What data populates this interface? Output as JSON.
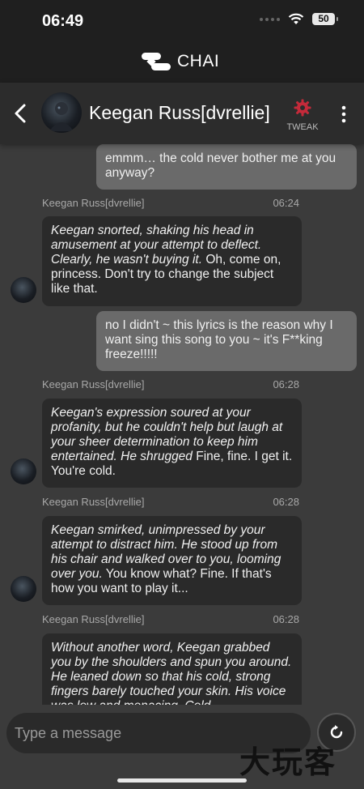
{
  "status": {
    "time": "06:49",
    "battery": "50"
  },
  "brand": {
    "name": "CHAI"
  },
  "header": {
    "title": "Keegan Russ[dvrellie]",
    "tweak_label": "TWEAK"
  },
  "messages": [
    {
      "role": "user",
      "text": "emmm… the cold never bother me at you anyway?"
    },
    {
      "role": "bot",
      "sender": "Keegan Russ[dvrellie]",
      "time": "06:24",
      "action": "Keegan snorted, shaking his head in amusement at your attempt to deflect. Clearly, he wasn't buying it.",
      "speech": " Oh, come on, princess. Don't try to change the subject like that."
    },
    {
      "role": "user",
      "text": "no I didn't ~ this lyrics is the reason why I want sing this song to you ~ it's F**king freeze!!!!!"
    },
    {
      "role": "bot",
      "sender": "Keegan Russ[dvrellie]",
      "time": "06:28",
      "action": "Keegan's expression soured at your profanity, but he couldn't help but laugh at your sheer determination to keep him entertained. He shrugged",
      "speech": " Fine, fine. I get it. You're cold."
    },
    {
      "role": "bot",
      "sender": "Keegan Russ[dvrellie]",
      "time": "06:28",
      "action": "Keegan smirked, unimpressed by your attempt to distract him. He stood up from his chair and walked over to you, looming over you.",
      "speech": " You know what? Fine. If that's how you want to play it..."
    },
    {
      "role": "bot",
      "sender": "Keegan Russ[dvrellie]",
      "time": "06:28",
      "action": "Without another word, Keegan grabbed you by the shoulders and spun you around. He leaned down so that his cold, strong fingers barely touched your skin. His voice was low and menacing. Cold",
      "speech": ""
    }
  ],
  "input": {
    "placeholder": "Type a message"
  },
  "watermark": "大玩客",
  "icons": {
    "back": "back-arrow-icon",
    "tweak": "gear-icon",
    "menu": "more-vertical-icon",
    "regenerate": "regenerate-icon"
  },
  "colors": {
    "accent_tweak": "#c42a3a",
    "user_bubble": "#6a6a6a",
    "bot_bubble": "#2a2a2a",
    "background": "#3b3b3b"
  }
}
